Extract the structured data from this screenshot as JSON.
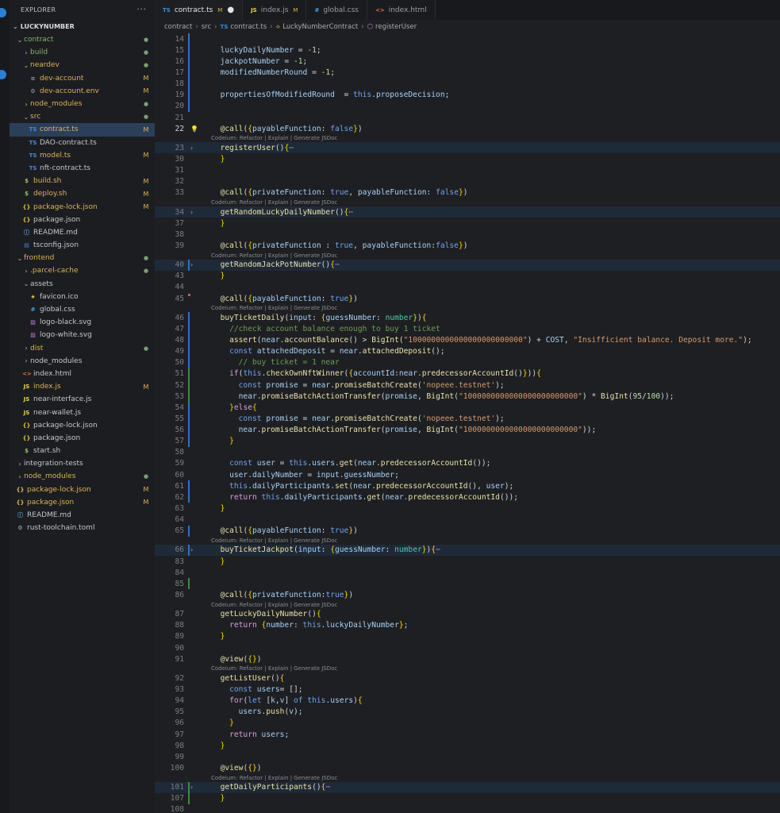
{
  "explorer": {
    "title": "EXPLORER",
    "more": "···",
    "root": "LUCKYNUMBER",
    "items": [
      {
        "depth": 1,
        "type": "folder",
        "open": true,
        "label": "contract",
        "badge": "dot",
        "color": "green"
      },
      {
        "depth": 2,
        "type": "folder",
        "open": false,
        "label": "build",
        "badge": "dot",
        "color": "green"
      },
      {
        "depth": 2,
        "type": "folder",
        "open": true,
        "label": "neardev",
        "badge": "dot",
        "color": "mod"
      },
      {
        "depth": 3,
        "type": "file",
        "icon": "≡",
        "iconClass": "ic-acct",
        "label": "dev-account",
        "badge": "M",
        "color": "mod"
      },
      {
        "depth": 3,
        "type": "file",
        "icon": "⚙",
        "iconClass": "ic-env",
        "label": "dev-account.env",
        "badge": "M",
        "color": "mod"
      },
      {
        "depth": 2,
        "type": "folder",
        "open": false,
        "label": "node_modules",
        "badge": "dot",
        "color": "mod"
      },
      {
        "depth": 2,
        "type": "folder",
        "open": true,
        "label": "src",
        "badge": "dot",
        "color": "mod"
      },
      {
        "depth": 3,
        "type": "file",
        "icon": "TS",
        "iconClass": "ic-ts",
        "label": "contract.ts",
        "badge": "M",
        "color": "mod",
        "active": true
      },
      {
        "depth": 3,
        "type": "file",
        "icon": "TS",
        "iconClass": "ic-ts",
        "label": "DAO-contract.ts",
        "badge": "",
        "color": ""
      },
      {
        "depth": 3,
        "type": "file",
        "icon": "TS",
        "iconClass": "ic-ts",
        "label": "model.ts",
        "badge": "M",
        "color": "mod"
      },
      {
        "depth": 3,
        "type": "file",
        "icon": "TS",
        "iconClass": "ic-ts",
        "label": "nft-contract.ts",
        "badge": "",
        "color": ""
      },
      {
        "depth": 2,
        "type": "file",
        "icon": "$",
        "iconClass": "ic-sh",
        "label": "build.sh",
        "badge": "M",
        "color": "mod"
      },
      {
        "depth": 2,
        "type": "file",
        "icon": "$",
        "iconClass": "ic-sh",
        "label": "deploy.sh",
        "badge": "M",
        "color": "mod"
      },
      {
        "depth": 2,
        "type": "file",
        "icon": "{}",
        "iconClass": "ic-json",
        "label": "package-lock.json",
        "badge": "M",
        "color": "mod"
      },
      {
        "depth": 2,
        "type": "file",
        "icon": "{}",
        "iconClass": "ic-json",
        "label": "package.json",
        "badge": "",
        "color": ""
      },
      {
        "depth": 2,
        "type": "file",
        "icon": "ⓘ",
        "iconClass": "ic-info",
        "label": "README.md",
        "badge": "",
        "color": ""
      },
      {
        "depth": 2,
        "type": "file",
        "icon": "▤",
        "iconClass": "ic-ts",
        "label": "tsconfig.json",
        "badge": "",
        "color": ""
      },
      {
        "depth": 1,
        "type": "folder",
        "open": true,
        "label": "frontend",
        "badge": "dot",
        "color": "mod"
      },
      {
        "depth": 2,
        "type": "folder",
        "open": false,
        "label": ".parcel-cache",
        "badge": "dot",
        "color": "mod"
      },
      {
        "depth": 2,
        "type": "folder",
        "open": true,
        "label": "assets",
        "badge": "",
        "color": ""
      },
      {
        "depth": 3,
        "type": "file",
        "icon": "★",
        "iconClass": "ic-star",
        "label": "favicon.ico",
        "badge": "",
        "color": ""
      },
      {
        "depth": 3,
        "type": "file",
        "icon": "#",
        "iconClass": "ic-css",
        "label": "global.css",
        "badge": "",
        "color": ""
      },
      {
        "depth": 3,
        "type": "file",
        "icon": "▨",
        "iconClass": "ic-svg",
        "label": "logo-black.svg",
        "badge": "",
        "color": ""
      },
      {
        "depth": 3,
        "type": "file",
        "icon": "▨",
        "iconClass": "ic-svg",
        "label": "logo-white.svg",
        "badge": "",
        "color": ""
      },
      {
        "depth": 2,
        "type": "folder",
        "open": false,
        "label": "dist",
        "badge": "dot",
        "color": "mod"
      },
      {
        "depth": 2,
        "type": "folder",
        "open": false,
        "label": "node_modules",
        "badge": "",
        "color": ""
      },
      {
        "depth": 2,
        "type": "file",
        "icon": "<>",
        "iconClass": "ic-html",
        "label": "index.html",
        "badge": "",
        "color": ""
      },
      {
        "depth": 2,
        "type": "file",
        "icon": "JS",
        "iconClass": "ic-js",
        "label": "index.js",
        "badge": "M",
        "color": "mod"
      },
      {
        "depth": 2,
        "type": "file",
        "icon": "JS",
        "iconClass": "ic-js",
        "label": "near-interface.js",
        "badge": "",
        "color": ""
      },
      {
        "depth": 2,
        "type": "file",
        "icon": "JS",
        "iconClass": "ic-js",
        "label": "near-wallet.js",
        "badge": "",
        "color": ""
      },
      {
        "depth": 2,
        "type": "file",
        "icon": "{}",
        "iconClass": "ic-json",
        "label": "package-lock.json",
        "badge": "",
        "color": ""
      },
      {
        "depth": 2,
        "type": "file",
        "icon": "{}",
        "iconClass": "ic-json",
        "label": "package.json",
        "badge": "",
        "color": ""
      },
      {
        "depth": 2,
        "type": "file",
        "icon": "$",
        "iconClass": "ic-sh",
        "label": "start.sh",
        "badge": "",
        "color": ""
      },
      {
        "depth": 1,
        "type": "folder",
        "open": false,
        "label": "integration-tests",
        "badge": "",
        "color": ""
      },
      {
        "depth": 1,
        "type": "folder",
        "open": false,
        "label": "node_modules",
        "badge": "dot",
        "color": "mod"
      },
      {
        "depth": 1,
        "type": "file",
        "icon": "{}",
        "iconClass": "ic-json",
        "label": "package-lock.json",
        "badge": "M",
        "color": "mod"
      },
      {
        "depth": 1,
        "type": "file",
        "icon": "{}",
        "iconClass": "ic-json",
        "label": "package.json",
        "badge": "M",
        "color": "mod"
      },
      {
        "depth": 1,
        "type": "file",
        "icon": "ⓘ",
        "iconClass": "ic-info",
        "label": "README.md",
        "badge": "",
        "color": ""
      },
      {
        "depth": 1,
        "type": "file",
        "icon": "⚙",
        "iconClass": "ic-gear",
        "label": "rust-toolchain.toml",
        "badge": "",
        "color": ""
      }
    ]
  },
  "tabs": [
    {
      "icon": "TS",
      "iconClass": "ic-ts",
      "label": "contract.ts",
      "mod": "M",
      "dirty": true,
      "active": true
    },
    {
      "icon": "JS",
      "iconClass": "ic-js",
      "label": "index.js",
      "mod": "M",
      "dirty": false,
      "active": false
    },
    {
      "icon": "#",
      "iconClass": "ic-css",
      "label": "global.css",
      "mod": "",
      "dirty": false,
      "active": false
    },
    {
      "icon": "<>",
      "iconClass": "ic-html",
      "label": "index.html",
      "mod": "",
      "dirty": false,
      "active": false
    }
  ],
  "breadcrumb": {
    "parts": [
      "contract",
      "src"
    ],
    "file_icon": "TS",
    "file": "contract.ts",
    "class_icon": "⟡",
    "class": "LuckyNumberContract",
    "method_icon": "⬡",
    "method": "registerUser"
  },
  "codelens": "Codeium: Refactor | Explain | Generate JSDoc",
  "lines": [
    {
      "n": "14",
      "bar": "blue",
      "html": ""
    },
    {
      "n": "15",
      "bar": "blue",
      "html": "  <span class='v'>luckyDailyNumber</span> = <span class='n'>-1</span>;"
    },
    {
      "n": "16",
      "bar": "blue",
      "html": "  <span class='v'>jackpotNumber</span> = <span class='n'>-1</span>;"
    },
    {
      "n": "17",
      "bar": "blue",
      "html": "  <span class='v'>modifiedNumberRound</span> = <span class='n'>-1</span>;"
    },
    {
      "n": "18",
      "bar": "blue",
      "html": ""
    },
    {
      "n": "19",
      "bar": "blue",
      "html": "  <span class='v'>propertiesOfModifiedRound</span>  = <span class='k'>this</span>.<span class='v'>proposeDecision</span>;"
    },
    {
      "n": "20",
      "bar": "blue",
      "html": ""
    },
    {
      "n": "21",
      "bar": "",
      "html": ""
    },
    {
      "n": "22",
      "bar": "",
      "bulb": true,
      "html": "  <span class='f'>@call</span>(<span class='y'>{</span><span class='v'>payableFunction</span>: <span class='k'>false</span><span class='y'>}</span>)"
    },
    {
      "cl": true
    },
    {
      "n": "23",
      "bar": "",
      "fold": true,
      "hl": true,
      "html": "  <span class='f'>registerUser</span>()<span class='y'>{</span><span class='ell'>⋯</span>"
    },
    {
      "n": "30",
      "bar": "",
      "html": "  <span class='y'>}</span>"
    },
    {
      "n": "31",
      "bar": "",
      "html": ""
    },
    {
      "n": "32",
      "bar": "",
      "html": ""
    },
    {
      "n": "33",
      "bar": "",
      "html": "  <span class='f'>@call</span>(<span class='y'>{</span><span class='v'>privateFunction</span>: <span class='k'>true</span>, <span class='v'>payableFunction</span>: <span class='k'>false</span><span class='y'>}</span>)"
    },
    {
      "cl": true
    },
    {
      "n": "34",
      "bar": "",
      "fold": true,
      "hl": true,
      "html": "  <span class='f'>getRandomLuckyDailyNumber</span>()<span class='y'>{</span><span class='ell'>⋯</span>"
    },
    {
      "n": "37",
      "bar": "",
      "html": "  <span class='y'>}</span>"
    },
    {
      "n": "38",
      "bar": "",
      "html": ""
    },
    {
      "n": "39",
      "bar": "",
      "html": "  <span class='f'>@call</span>(<span class='y'>{</span><span class='v'>privateFunction</span> : <span class='k'>true</span>, <span class='v'>payableFunction</span>:<span class='k'>false</span><span class='y'>}</span>)"
    },
    {
      "cl": true
    },
    {
      "n": "40",
      "bar": "blue",
      "fold": true,
      "hl": true,
      "html": "  <span class='f'>getRandomJackPotNumber</span>()<span class='y'>{</span><span class='ell'>⋯</span>"
    },
    {
      "n": "43",
      "bar": "",
      "html": "  <span class='y'>}</span>"
    },
    {
      "n": "44",
      "bar": "",
      "html": ""
    },
    {
      "n": "45",
      "bar": "",
      "err": true,
      "html": "  <span class='f'>@call</span>(<span class='y'>{</span><span class='v'>payableFunction</span>: <span class='k'>true</span><span class='y'>}</span>)"
    },
    {
      "cl": true
    },
    {
      "n": "46",
      "bar": "blue",
      "html": "  <span class='f'>buyTicketDaily</span>(<span class='v'>input</span>: <span class='y'>{</span><span class='v'>guessNumber</span>: <span class='t'>number</span><span class='y'>}</span>)<span class='y'>{</span>"
    },
    {
      "n": "47",
      "bar": "blue",
      "html": "    <span class='cm'>//check account balance enough to buy 1 ticket</span>"
    },
    {
      "n": "48",
      "bar": "blue",
      "html": "    <span class='f'>assert</span>(<span class='v'>near</span>.<span class='f'>accountBalance</span>() &gt; <span class='f'>BigInt</span>(<span class='s'>\"1000000000000000000000000\"</span>) + <span class='v'>COST</span>, <span class='s'>\"Insifficient balance. Deposit more.\"</span>);"
    },
    {
      "n": "49",
      "bar": "blue",
      "html": "    <span class='k'>const</span> <span class='v'>attachedDeposit</span> = <span class='v'>near</span>.<span class='f'>attachedDeposit</span>();"
    },
    {
      "n": "50",
      "bar": "blue",
      "html": "      <span class='cm'>// buy ticket = 1 near</span>"
    },
    {
      "n": "51",
      "bar": "green",
      "html": "    <span class='p'>if</span>(<span class='k'>this</span>.<span class='f'>checkOwnNftWinner</span>(<span class='y'>{</span><span class='v'>accountId</span>:<span class='v'>near</span>.<span class='f'>predecessorAccountId</span>()<span class='y'>}</span>))<span class='y'>{</span>"
    },
    {
      "n": "52",
      "bar": "green",
      "html": "      <span class='k'>const</span> <span class='v'>promise</span> = <span class='v'>near</span>.<span class='f'>promiseBatchCreate</span>(<span class='s'>'nopeee.testnet'</span>);"
    },
    {
      "n": "53",
      "bar": "green",
      "html": "      <span class='v'>near</span>.<span class='f'>promiseBatchActionTransfer</span>(<span class='v'>promise</span>, <span class='f'>BigInt</span>(<span class='s'>\"1000000000000000000000000\"</span>) * <span class='f'>BigInt</span>(<span class='n'>95</span>/<span class='n'>100</span>));"
    },
    {
      "n": "54",
      "bar": "blue",
      "html": "    <span class='y'>}</span><span class='p'>else</span><span class='y'>{</span>"
    },
    {
      "n": "55",
      "bar": "blue",
      "html": "      <span class='k'>const</span> <span class='v'>promise</span> = <span class='v'>near</span>.<span class='f'>promiseBatchCreate</span>(<span class='s'>'nopeee.testnet'</span>);"
    },
    {
      "n": "56",
      "bar": "blue",
      "html": "      <span class='v'>near</span>.<span class='f'>promiseBatchActionTransfer</span>(<span class='v'>promise</span>, <span class='f'>BigInt</span>(<span class='s'>\"1000000000000000000000000\"</span>));"
    },
    {
      "n": "57",
      "bar": "blue",
      "html": "    <span class='y'>}</span>"
    },
    {
      "n": "58",
      "bar": "",
      "html": ""
    },
    {
      "n": "59",
      "bar": "",
      "html": "    <span class='k'>const</span> <span class='v'>user</span> = <span class='k'>this</span>.<span class='v'>users</span>.<span class='f'>get</span>(<span class='v'>near</span>.<span class='f'>predecessorAccountId</span>());"
    },
    {
      "n": "60",
      "bar": "",
      "html": "    <span class='v'>user</span>.<span class='v'>dailyNumber</span> = <span class='v'>input</span>.<span class='v'>guessNumber</span>;"
    },
    {
      "n": "61",
      "bar": "blue",
      "html": "    <span class='k'>this</span>.<span class='v'>dailyParticipants</span>.<span class='f'>set</span>(<span class='v'>near</span>.<span class='f'>predecessorAccountId</span>(), <span class='v'>user</span>);"
    },
    {
      "n": "62",
      "bar": "blue",
      "html": "    <span class='p'>return</span> <span class='k'>this</span>.<span class='v'>dailyParticipants</span>.<span class='f'>get</span>(<span class='v'>near</span>.<span class='f'>predecessorAccountId</span>());"
    },
    {
      "n": "63",
      "bar": "",
      "html": "  <span class='y'>}</span>"
    },
    {
      "n": "64",
      "bar": "",
      "html": ""
    },
    {
      "n": "65",
      "bar": "blue",
      "html": "  <span class='f'>@call</span>(<span class='y'>{</span><span class='v'>payableFunction</span>: <span class='k'>true</span><span class='y'>}</span>)"
    },
    {
      "cl": true
    },
    {
      "n": "66",
      "bar": "blue",
      "fold": true,
      "hl": true,
      "html": "  <span class='f'>buyTicketJackpot</span>(<span class='v'>input</span>: <span class='y'>{</span><span class='v'>guessNumber</span>: <span class='t'>number</span><span class='y'>}</span>)<span class='y'>{</span><span class='ell'>⋯</span>"
    },
    {
      "n": "83",
      "bar": "",
      "html": "  <span class='y'>}</span>"
    },
    {
      "n": "84",
      "bar": "",
      "html": ""
    },
    {
      "n": "85",
      "bar": "green",
      "html": ""
    },
    {
      "n": "86",
      "bar": "",
      "html": "  <span class='f'>@call</span>(<span class='y'>{</span><span class='v'>privateFunction</span>:<span class='k'>true</span><span class='y'>}</span>)"
    },
    {
      "cl": true
    },
    {
      "n": "87",
      "bar": "",
      "html": "  <span class='f'>getLuckyDailyNumber</span>()<span class='y'>{</span>"
    },
    {
      "n": "88",
      "bar": "",
      "html": "    <span class='p'>return</span> <span class='y'>{</span><span class='v'>number</span>: <span class='k'>this</span>.<span class='v'>luckyDailyNumber</span><span class='y'>}</span>;"
    },
    {
      "n": "89",
      "bar": "",
      "html": "  <span class='y'>}</span>"
    },
    {
      "n": "90",
      "bar": "",
      "html": ""
    },
    {
      "n": "91",
      "bar": "",
      "html": "  <span class='f'>@view</span>(<span class='y'>{}</span>)"
    },
    {
      "cl": true
    },
    {
      "n": "92",
      "bar": "",
      "html": "  <span class='f'>getListUser</span>()<span class='y'>{</span>"
    },
    {
      "n": "93",
      "bar": "",
      "html": "    <span class='k'>const</span> <span class='v'>users</span>= [];"
    },
    {
      "n": "94",
      "bar": "",
      "html": "    <span class='p'>for</span>(<span class='k'>let</span> [<span class='v'>k</span>,<span class='v'>v</span>] <span class='k'>of</span> <span class='k'>this</span>.<span class='v'>users</span>)<span class='y'>{</span>"
    },
    {
      "n": "95",
      "bar": "",
      "html": "      <span class='v'>users</span>.<span class='f'>push</span>(<span class='v'>v</span>);"
    },
    {
      "n": "96",
      "bar": "",
      "html": "    <span class='y'>}</span>"
    },
    {
      "n": "97",
      "bar": "",
      "html": "    <span class='p'>return</span> <span class='v'>users</span>;"
    },
    {
      "n": "98",
      "bar": "",
      "html": "  <span class='y'>}</span>"
    },
    {
      "n": "99",
      "bar": "",
      "html": ""
    },
    {
      "n": "100",
      "bar": "",
      "html": "  <span class='f'>@view</span>(<span class='y'>{}</span>)"
    },
    {
      "cl": true
    },
    {
      "n": "101",
      "bar": "green",
      "fold": true,
      "hl": true,
      "html": "  <span class='f'>getDailyParticipants</span>()<span class='y'>{</span><span class='ell'>⋯</span>"
    },
    {
      "n": "107",
      "bar": "green",
      "html": "  <span class='y'>}</span>"
    },
    {
      "n": "108",
      "bar": "",
      "html": ""
    }
  ]
}
